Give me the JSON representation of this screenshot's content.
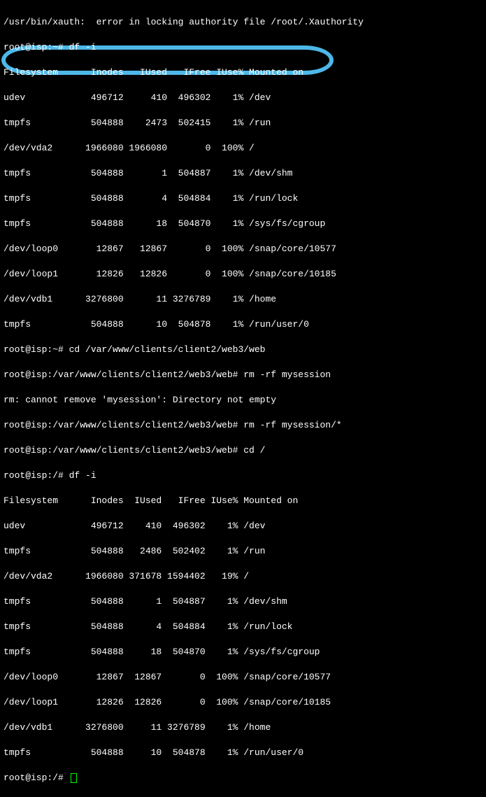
{
  "lines": {
    "l0": "/usr/bin/xauth:  error in locking authority file /root/.Xauthority",
    "l1": "root@isp:~# df -i",
    "l2": "Filesystem      Inodes   IUsed   IFree IUse% Mounted on",
    "l3": "udev            496712     410  496302    1% /dev",
    "l4": "tmpfs           504888    2473  502415    1% /run",
    "l5": "/dev/vda2      1966080 1966080       0  100% /",
    "l6": "tmpfs           504888       1  504887    1% /dev/shm",
    "l7": "tmpfs           504888       4  504884    1% /run/lock",
    "l8": "tmpfs           504888      18  504870    1% /sys/fs/cgroup",
    "l9": "/dev/loop0       12867   12867       0  100% /snap/core/10577",
    "l10": "/dev/loop1       12826   12826       0  100% /snap/core/10185",
    "l11": "/dev/vdb1      3276800      11 3276789    1% /home",
    "l12": "tmpfs           504888      10  504878    1% /run/user/0",
    "l13": "root@isp:~# cd /var/www/clients/client2/web3/web",
    "l14": "root@isp:/var/www/clients/client2/web3/web# rm -rf mysession",
    "l15": "rm: cannot remove 'mysession': Directory not empty",
    "l16": "root@isp:/var/www/clients/client2/web3/web# rm -rf mysession/*",
    "l17": "root@isp:/var/www/clients/client2/web3/web# cd /",
    "l18": "root@isp:/# df -i",
    "l19": "Filesystem      Inodes  IUsed   IFree IUse% Mounted on",
    "l20": "udev            496712    410  496302    1% /dev",
    "l21": "tmpfs           504888   2486  502402    1% /run",
    "l22": "/dev/vda2      1966080 371678 1594402   19% /",
    "l23": "tmpfs           504888      1  504887    1% /dev/shm",
    "l24": "tmpfs           504888      4  504884    1% /run/lock",
    "l25": "tmpfs           504888     18  504870    1% /sys/fs/cgroup",
    "l26": "/dev/loop0       12867  12867       0  100% /snap/core/10577",
    "l27": "/dev/loop1       12826  12826       0  100% /snap/core/10185",
    "l28": "/dev/vdb1      3276800     11 3276789    1% /home",
    "l29": "tmpfs           504888     10  504878    1% /run/user/0",
    "l30": "root@isp:/# "
  }
}
